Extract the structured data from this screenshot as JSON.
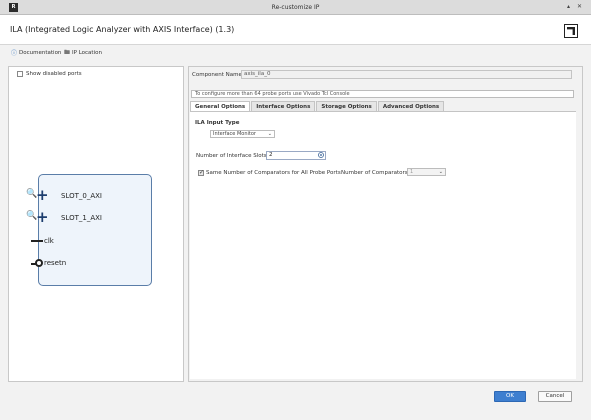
{
  "window": {
    "title": "Re-customize IP",
    "minimize_symbol": "▴",
    "close_symbol": "✕"
  },
  "header": {
    "title": "ILA (Integrated Logic Analyzer with AXIS Interface) (1.3)",
    "logo": "amd-logo"
  },
  "links": {
    "documentation": "Documentation",
    "documentation_icon": "info-icon",
    "ip_location": "IP Location",
    "ip_location_icon": "folder-icon"
  },
  "left": {
    "show_disabled_ports_label": "Show disabled ports",
    "show_disabled_ports_checked": false,
    "ports": [
      {
        "name": "SLOT_0_AXI",
        "type": "interface"
      },
      {
        "name": "SLOT_1_AXI",
        "type": "interface"
      },
      {
        "name": "clk",
        "type": "clock"
      },
      {
        "name": "resetn",
        "type": "reset"
      }
    ]
  },
  "right": {
    "component_name_label": "Component Name",
    "component_name_value": "axis_ila_0",
    "notice": "To configure more than 64 probe ports use Vivado Tcl Console",
    "tabs": [
      {
        "label": "General Options",
        "active": true
      },
      {
        "label": "Interface Options",
        "active": false
      },
      {
        "label": "Storage Options",
        "active": false
      },
      {
        "label": "Advanced Options",
        "active": false
      }
    ],
    "ila_input_type_title": "ILA Input Type",
    "ila_input_type_value": "Interface Monitor",
    "num_interface_slots_label": "Number of Interface Slots",
    "num_interface_slots_value": "2",
    "same_comparators_label": "Same Number of Comparators for All Probe Ports",
    "same_comparators_checked": true,
    "num_comparators_label": "Number of Comparators",
    "num_comparators_value": "1"
  },
  "footer": {
    "ok_label": "OK",
    "cancel_label": "Cancel"
  },
  "colors": {
    "accent": "#3e7fd0",
    "ip_block_fill": "#eef4fb",
    "ip_block_border": "#5a7da8"
  }
}
